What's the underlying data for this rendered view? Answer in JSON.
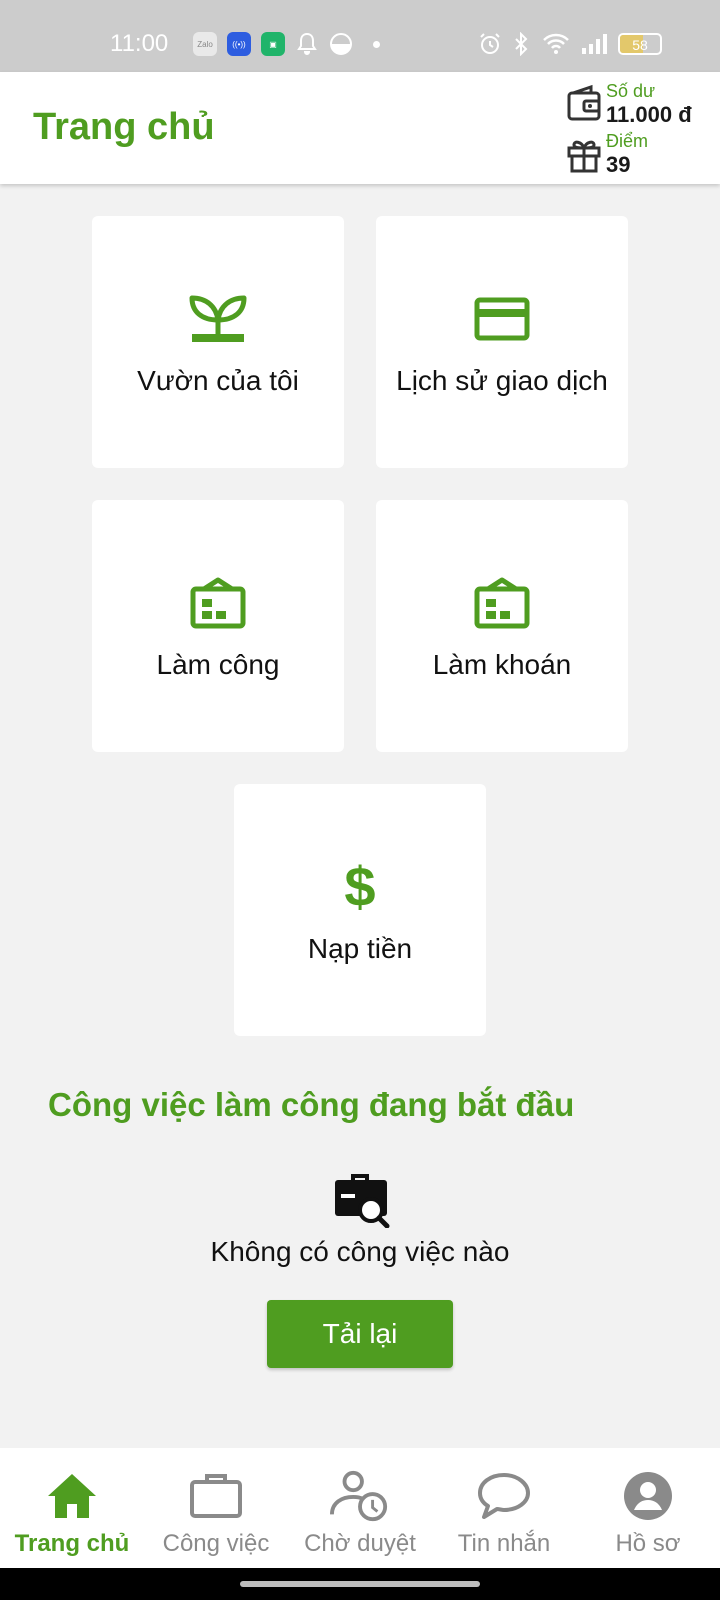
{
  "status_bar": {
    "time": "11:00",
    "battery": 58,
    "app_icons": [
      "zalo-icon",
      "hotspot-icon",
      "chat-icon",
      "bell-icon",
      "half-circle-icon"
    ],
    "system_icons": [
      "alarm-icon",
      "bluetooth-icon",
      "wifi-icon",
      "signal-icon"
    ]
  },
  "header": {
    "title": "Trang chủ",
    "balance_label": "Số dư",
    "balance_value": "11.000 đ",
    "points_label": "Điểm",
    "points_value": "39"
  },
  "cards": [
    {
      "label": "Vườn của tôi",
      "icon": "sprout-icon"
    },
    {
      "label": "Lịch sử giao dịch",
      "icon": "credit-card-icon"
    },
    {
      "label": "Làm công",
      "icon": "building-icon"
    },
    {
      "label": "Làm khoán",
      "icon": "building-icon"
    },
    {
      "label": "Nạp tiền",
      "icon": "dollar-icon"
    }
  ],
  "section": {
    "title": "Công việc làm công đang bắt đầu",
    "empty_text": "Không có công việc nào",
    "reload_label": "Tải lại"
  },
  "bottom_nav": [
    {
      "label": "Trang chủ",
      "icon": "home-icon",
      "active": true
    },
    {
      "label": "Công việc",
      "icon": "briefcase-icon",
      "active": false
    },
    {
      "label": "Chờ duyệt",
      "icon": "pending-user-icon",
      "active": false
    },
    {
      "label": "Tin nhắn",
      "icon": "chat-bubble-icon",
      "active": false
    },
    {
      "label": "Hồ sơ",
      "icon": "profile-icon",
      "active": false
    }
  ],
  "colors": {
    "accent": "#4f9d20",
    "background": "#f2f2f2",
    "nav_inactive": "#8a8a8a"
  }
}
